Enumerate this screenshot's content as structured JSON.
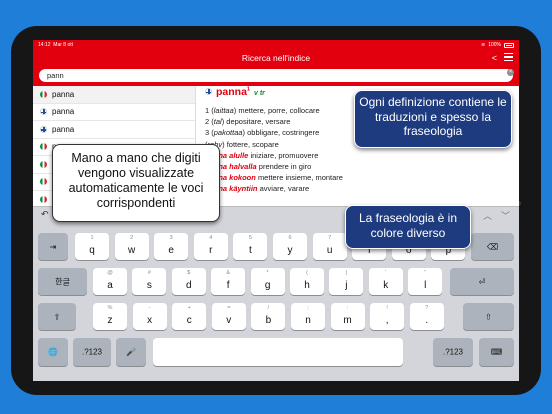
{
  "status": {
    "time": "14:12",
    "date": "Mar 8 ott",
    "battery": "100%"
  },
  "nav": {
    "title": "Ricerca nell'indice"
  },
  "search": {
    "value": "pann"
  },
  "list": [
    {
      "flag": "it",
      "text": "panna",
      "selected": true
    },
    {
      "flag": "fi",
      "text": "panna"
    },
    {
      "flag": "fi",
      "text": "panna"
    },
    {
      "flag": "it",
      "text": "panna"
    },
    {
      "flag": "it",
      "text": "panna"
    },
    {
      "flag": "it",
      "text": "panna"
    },
    {
      "flag": "it",
      "text": "panna"
    }
  ],
  "entry": {
    "headword": "panna",
    "superscript": "1",
    "pos": "v tr",
    "senses": [
      {
        "num": "1",
        "note": "laittaa",
        "text": "mettere, porre, collocare"
      },
      {
        "num": "2",
        "note": "tal",
        "text": "depositare, versare"
      },
      {
        "num": "3",
        "note": "pakottaa",
        "text": "obbligare, costringere"
      },
      {
        "num": "",
        "note": "rahv",
        "text": "fottere, scopare"
      }
    ],
    "phrases": [
      {
        "phrase": "panna alulle",
        "text": "iniziare, promuovere"
      },
      {
        "phrase": "panna halvalla",
        "text": "prendere in giro"
      },
      {
        "phrase": "panna kokoon",
        "text": "mettere insieme, montare"
      },
      {
        "phrase": "panna käyntiin",
        "text": "avviare, varare"
      }
    ]
  },
  "keyboard": {
    "row1": [
      [
        "1",
        "q"
      ],
      [
        "2",
        "w"
      ],
      [
        "3",
        "e"
      ],
      [
        "4",
        "r"
      ],
      [
        "5",
        "t"
      ],
      [
        "6",
        "y"
      ],
      [
        "7",
        "u"
      ],
      [
        "8",
        "i"
      ],
      [
        "9",
        "o"
      ],
      [
        "0",
        "p"
      ]
    ],
    "row2": [
      [
        "@",
        "a"
      ],
      [
        "#",
        "s"
      ],
      [
        "$",
        "d"
      ],
      [
        "&",
        "f"
      ],
      [
        "*",
        "g"
      ],
      [
        "(",
        "h"
      ],
      [
        ")",
        "j"
      ],
      [
        "’",
        "k"
      ],
      [
        "”",
        "l"
      ]
    ],
    "row3": [
      [
        "%",
        "z"
      ],
      [
        "-",
        "x"
      ],
      [
        "+",
        "c"
      ],
      [
        "=",
        "v"
      ],
      [
        "/",
        "b"
      ],
      [
        ";",
        "n"
      ],
      [
        ":",
        "m"
      ],
      [
        "!",
        ","
      ],
      [
        "?",
        "."
      ]
    ],
    "tab_label": "⇥",
    "lang_label": "한글",
    "numbers_label": ".?123",
    "backspace_label": "⌫",
    "return_label": "⏎",
    "shift_label": "⇧",
    "globe_label": "🌐",
    "mic_label": "🎤",
    "hide_label": "⌨"
  },
  "callouts": {
    "definition": "Ogni definizione contiene le traduzioni e spesso la fraseologia",
    "list": "Mano a mano che digiti vengono visualizzate automaticamente le voci corrispondenti",
    "phraseology": "La fraseologia è in colore diverso"
  }
}
